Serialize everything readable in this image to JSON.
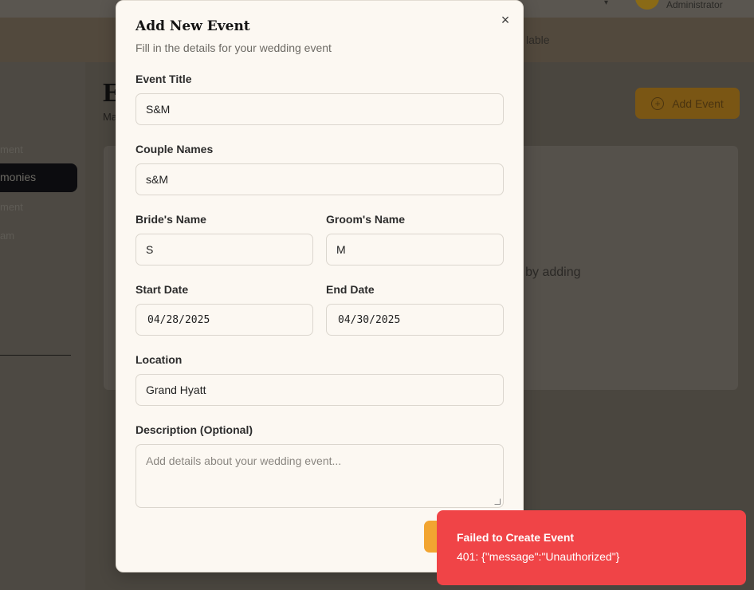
{
  "background": {
    "user_role": "Administrator",
    "subbar_text": "lable",
    "sidebar": [
      {
        "label": "ment"
      },
      {
        "label": "monies"
      },
      {
        "label": "ment"
      },
      {
        "label": "am"
      }
    ],
    "page_title_letter": "E",
    "page_subtitle": "Ma",
    "add_event_label": "Add Event",
    "empty_state_text": "art by adding"
  },
  "modal": {
    "title": "Add New Event",
    "description": "Fill in the details for your wedding event",
    "close_icon": "×",
    "fields": {
      "event_title": {
        "label": "Event Title",
        "value": "S&M"
      },
      "couple_names": {
        "label": "Couple Names",
        "value": "s&M"
      },
      "bride_name": {
        "label": "Bride's Name",
        "value": "S"
      },
      "groom_name": {
        "label": "Groom's Name",
        "value": "M"
      },
      "start_date": {
        "label": "Start Date",
        "value": "04/28/2025"
      },
      "end_date": {
        "label": "End Date",
        "value": "04/30/2025"
      },
      "location": {
        "label": "Location",
        "value": "Grand Hyatt"
      },
      "description": {
        "label": "Description (Optional)",
        "placeholder": "Add details about your wedding event..."
      }
    }
  },
  "toast": {
    "title": "Failed to Create Event",
    "message": "401: {\"message\":\"Unauthorized\"}"
  },
  "colors": {
    "accent": "#f2a531",
    "error": "#f04447",
    "modal_bg": "#fcf8f2"
  }
}
